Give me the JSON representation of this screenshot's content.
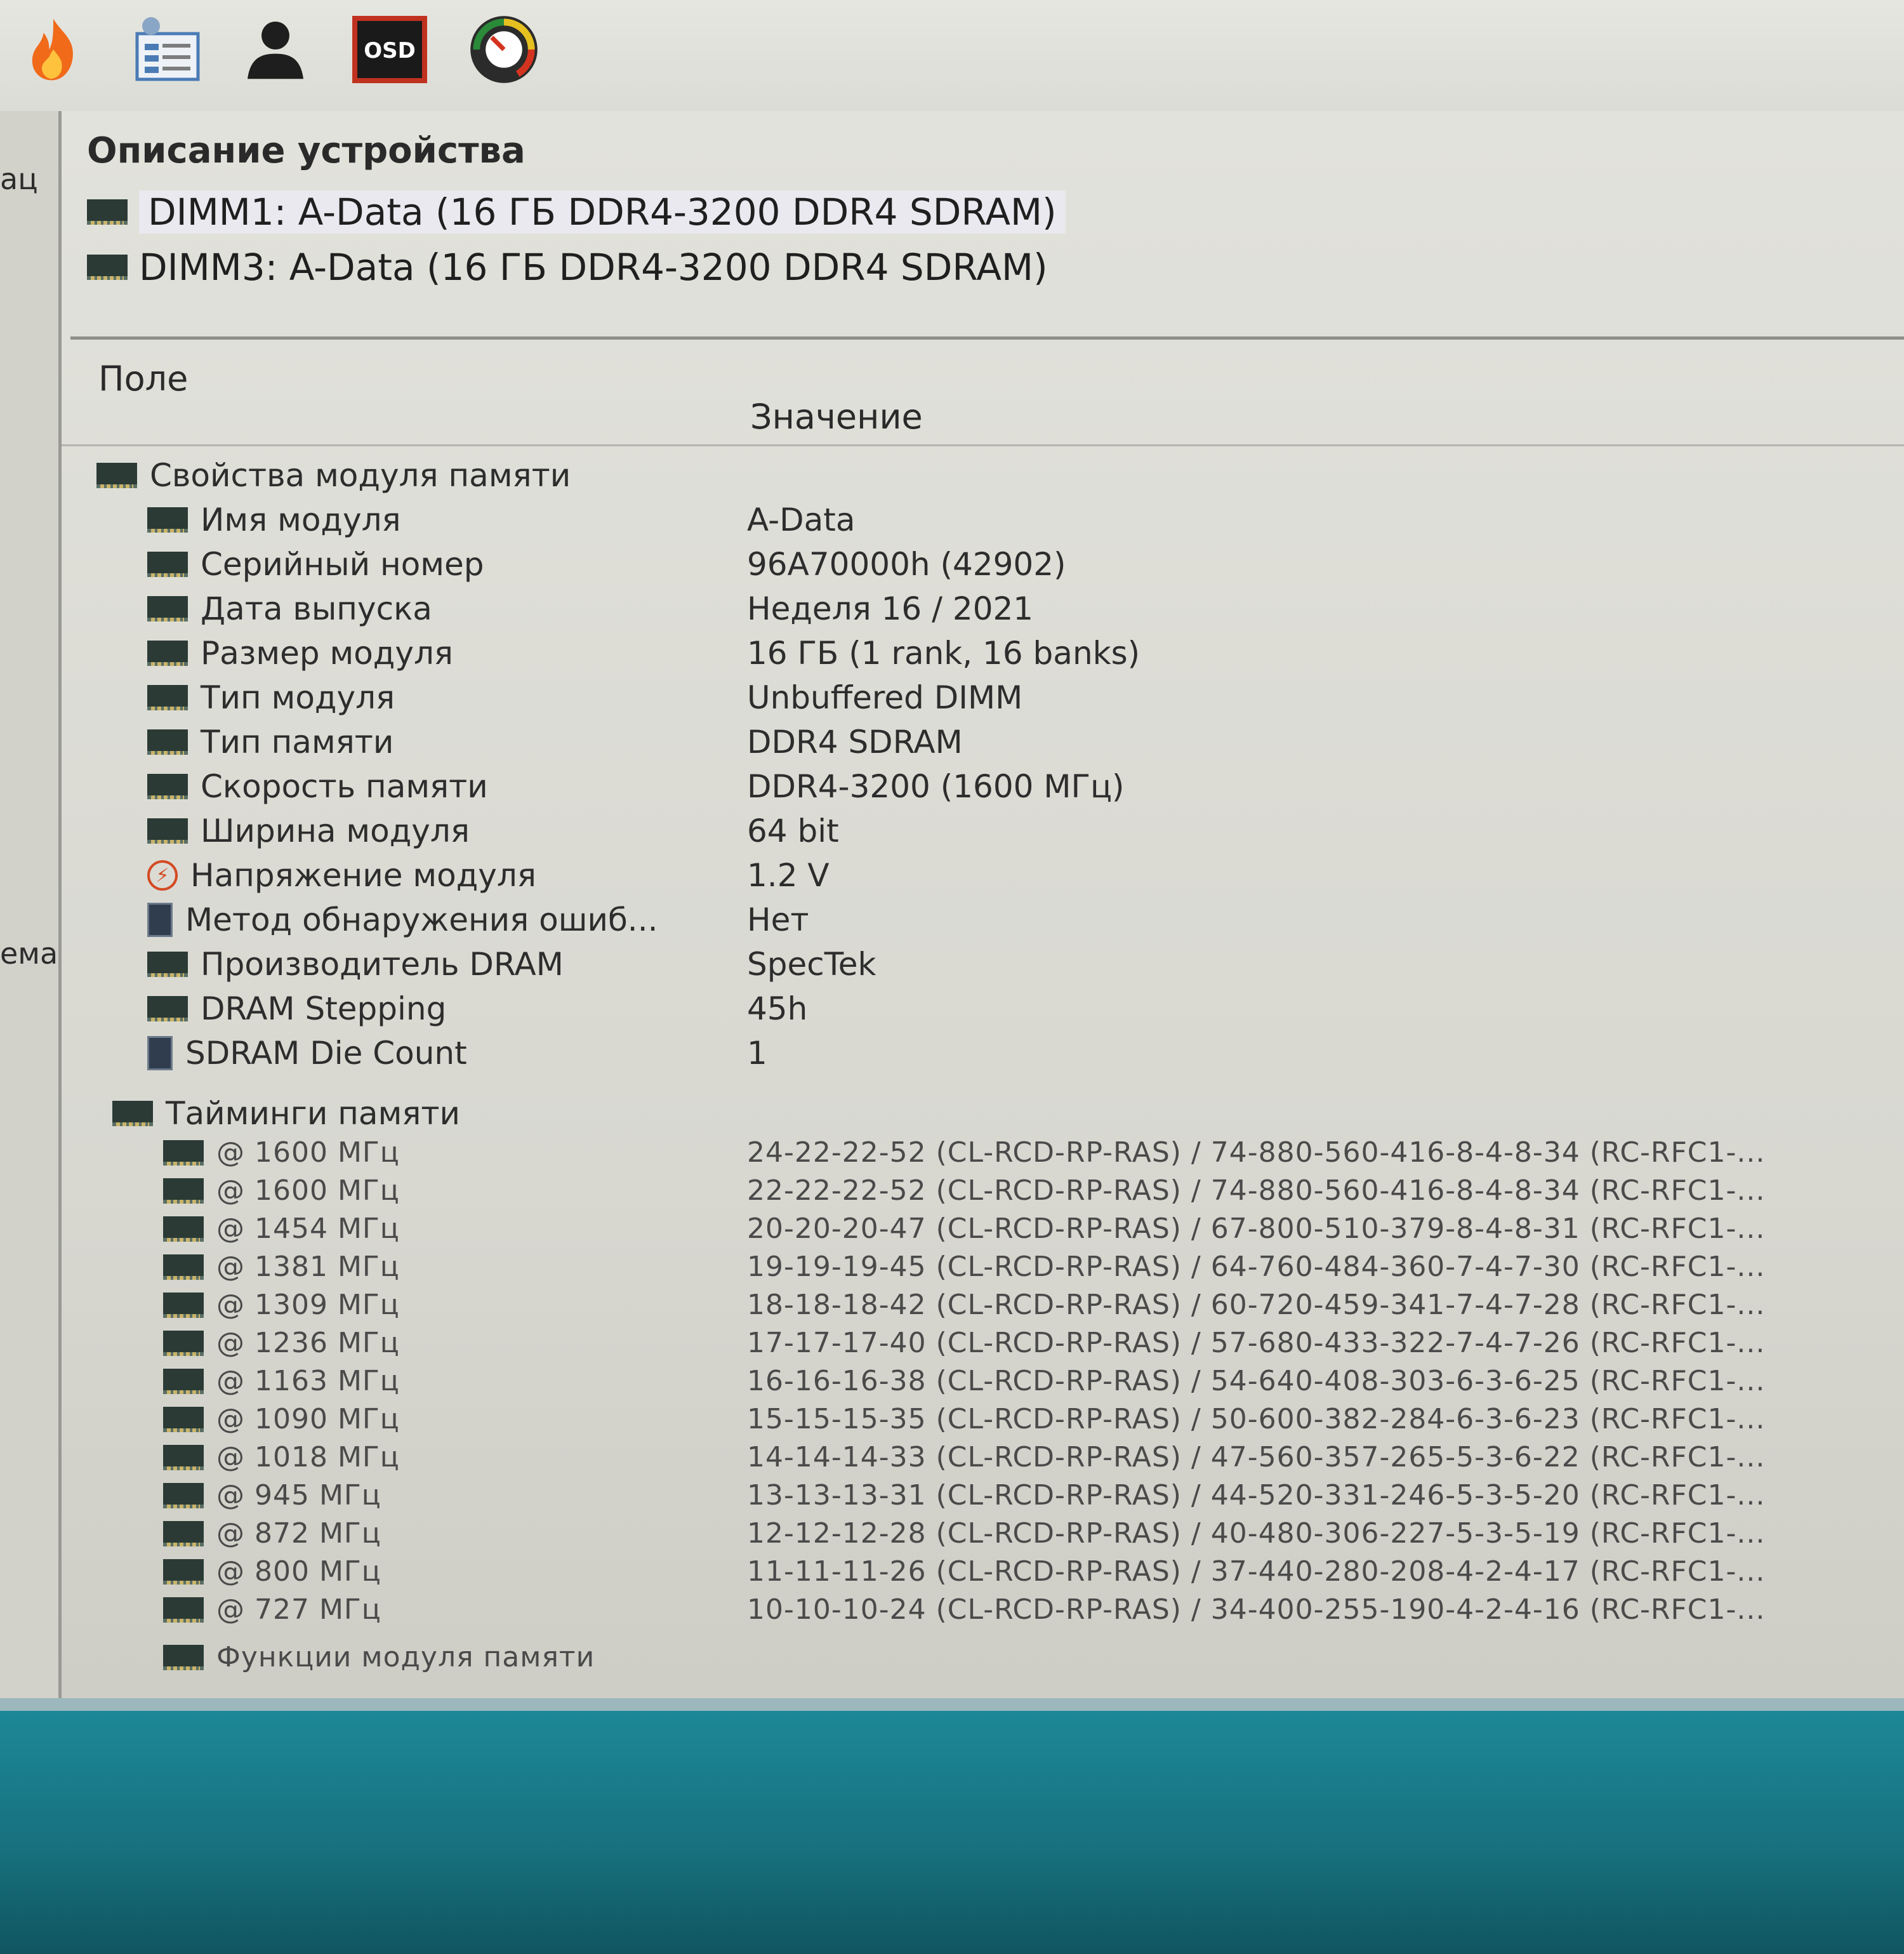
{
  "toolbar": {
    "icons": [
      {
        "name": "flame-icon",
        "color": "#f06a1a"
      },
      {
        "name": "system-info-icon",
        "color": "#4b7bb5"
      },
      {
        "name": "user-icon",
        "color": "#1e1e1e"
      },
      {
        "name": "osd-icon",
        "label": "OSD",
        "color": "#c0321f"
      },
      {
        "name": "gauge-icon",
        "color": "#2a8a3a"
      }
    ]
  },
  "left_strip": {
    "fragments": [
      "ац",
      "ема"
    ]
  },
  "device_panel": {
    "header": "Описание устройства",
    "items": [
      {
        "label": "DIMM1: A-Data (16 ГБ DDR4-3200 DDR4 SDRAM)",
        "selected": true
      },
      {
        "label": "DIMM3: A-Data (16 ГБ DDR4-3200 DDR4 SDRAM)",
        "selected": false
      }
    ]
  },
  "table": {
    "headers": {
      "field": "Поле",
      "value": "Значение"
    },
    "properties_group": "Свойства модуля памяти",
    "fields": [
      {
        "label": "Имя модуля",
        "icon": "ram-icon"
      },
      {
        "label": "Серийный номер",
        "icon": "ram-icon"
      },
      {
        "label": "Дата выпуска",
        "icon": "ram-icon"
      },
      {
        "label": "Размер модуля",
        "icon": "ram-icon"
      },
      {
        "label": "Тип модуля",
        "icon": "ram-icon"
      },
      {
        "label": "Тип памяти",
        "icon": "ram-icon"
      },
      {
        "label": "Скорость памяти",
        "icon": "ram-icon"
      },
      {
        "label": "Ширина модуля",
        "icon": "ram-icon"
      },
      {
        "label": "Напряжение модуля",
        "icon": "bolt-icon"
      },
      {
        "label": "Метод обнаружения ошиб...",
        "icon": "chip-icon"
      },
      {
        "label": "Производитель DRAM",
        "icon": "ram-icon"
      },
      {
        "label": "DRAM Stepping",
        "icon": "ram-icon"
      },
      {
        "label": "SDRAM Die Count",
        "icon": "chip-icon"
      }
    ],
    "values": [
      "A-Data",
      "96A70000h (42902)",
      "Неделя 16 / 2021",
      "16 ГБ (1 rank, 16 banks)",
      "Unbuffered DIMM",
      "DDR4 SDRAM",
      "DDR4-3200 (1600 МГц)",
      "64 bit",
      "1.2 V",
      "Нет",
      "SpecTek",
      "45h",
      "1"
    ],
    "timings_group": "Тайминги памяти",
    "timings": [
      {
        "freq": "@ 1600 МГц",
        "value": "24-22-22-52  (CL-RCD-RP-RAS) / 74-880-560-416-8-4-8-34  (RC-RFC1-..."
      },
      {
        "freq": "@ 1600 МГц",
        "value": "22-22-22-52  (CL-RCD-RP-RAS) / 74-880-560-416-8-4-8-34  (RC-RFC1-..."
      },
      {
        "freq": "@ 1454 МГц",
        "value": "20-20-20-47  (CL-RCD-RP-RAS) / 67-800-510-379-8-4-8-31  (RC-RFC1-..."
      },
      {
        "freq": "@ 1381 МГц",
        "value": "19-19-19-45  (CL-RCD-RP-RAS) / 64-760-484-360-7-4-7-30  (RC-RFC1-..."
      },
      {
        "freq": "@ 1309 МГц",
        "value": "18-18-18-42  (CL-RCD-RP-RAS) / 60-720-459-341-7-4-7-28  (RC-RFC1-..."
      },
      {
        "freq": "@ 1236 МГц",
        "value": "17-17-17-40  (CL-RCD-RP-RAS) / 57-680-433-322-7-4-7-26  (RC-RFC1-..."
      },
      {
        "freq": "@ 1163 МГц",
        "value": "16-16-16-38  (CL-RCD-RP-RAS) / 54-640-408-303-6-3-6-25  (RC-RFC1-..."
      },
      {
        "freq": "@ 1090 МГц",
        "value": "15-15-15-35  (CL-RCD-RP-RAS) / 50-600-382-284-6-3-6-23  (RC-RFC1-..."
      },
      {
        "freq": "@ 1018 МГц",
        "value": "14-14-14-33  (CL-RCD-RP-RAS) / 47-560-357-265-5-3-6-22  (RC-RFC1-..."
      },
      {
        "freq": "@ 945 МГц",
        "value": "13-13-13-31  (CL-RCD-RP-RAS) / 44-520-331-246-5-3-5-20  (RC-RFC1-..."
      },
      {
        "freq": "@ 872 МГц",
        "value": "12-12-12-28  (CL-RCD-RP-RAS) / 40-480-306-227-5-3-5-19  (RC-RFC1-..."
      },
      {
        "freq": "@ 800 МГц",
        "value": "11-11-11-26  (CL-RCD-RP-RAS) / 37-440-280-208-4-2-4-17  (RC-RFC1-..."
      },
      {
        "freq": "@ 727 МГц",
        "value": "10-10-10-24  (CL-RCD-RP-RAS) / 34-400-255-190-4-2-4-16  (RC-RFC1-..."
      }
    ],
    "features_group": "Функции модуля памяти"
  }
}
